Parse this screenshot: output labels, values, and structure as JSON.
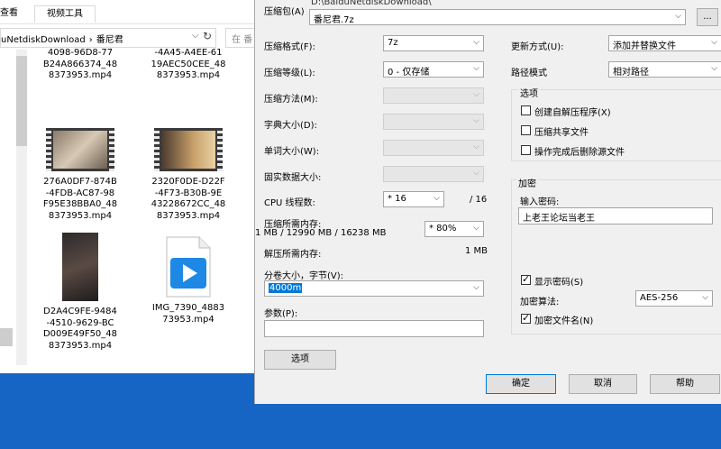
{
  "explorer": {
    "ribbon": {
      "tab_view": "查看",
      "tab_video_tools": "视频工具"
    },
    "address": {
      "segment1": "uNetdiskDownload",
      "segment2": "番尼君",
      "separator": "›"
    },
    "search_placeholder": "在 番",
    "files": [
      {
        "lines": [
          "4098-96D8-77",
          "B24A866374_48",
          "8373953.mp4"
        ]
      },
      {
        "lines": [
          "-4A45-A4EE-61",
          "19AEC50CEE_48",
          "8373953.mp4"
        ]
      },
      {
        "lines": [
          "276A0DF7-874B",
          "-4FDB-AC87-98",
          "F95E38BBA0_48",
          "8373953.mp4"
        ]
      },
      {
        "lines": [
          "2320F0DE-D22F",
          "-4F73-B30B-9E",
          "43228672CC_48",
          "8373953.mp4"
        ]
      },
      {
        "lines": [
          "D2A4C9FE-9484",
          "-4510-9629-BC",
          "D009E49F50_48",
          "8373953.mp4"
        ]
      },
      {
        "lines": [
          "IMG_7390_4883",
          "73953.mp4"
        ]
      }
    ]
  },
  "dialog": {
    "archive_label": "压缩包(A)",
    "archive_path": "D:\\BaiduNetdiskDownload\\",
    "archive_name": "番尼君.7z",
    "browse_label": "...",
    "format_label": "压缩格式(F):",
    "format_value": "7z",
    "level_label": "压缩等级(L):",
    "level_value": "0 - 仅存储",
    "method_label": "压缩方法(M):",
    "dict_label": "字典大小(D):",
    "word_label": "单词大小(W):",
    "solid_label": "固实数据大小:",
    "threads_label": "CPU 线程数:",
    "threads_value": "* 16",
    "threads_total": "/ 16",
    "mem_comp_label": "压缩所需内存:",
    "mem_comp_detail": "1 MB / 12990 MB / 16238 MB",
    "mem_comp_percent": "* 80%",
    "mem_decomp_label": "解压所需内存:",
    "mem_decomp_value": "1 MB",
    "volume_label": "分卷大小，字节(V):",
    "volume_value": "4000m",
    "params_label": "参数(P):",
    "options_button": "选项",
    "update_label": "更新方式(U):",
    "update_value": "添加并替换文件",
    "path_label": "路径模式",
    "path_value": "相对路径",
    "options_group_title": "选项",
    "opt_sfx": "创建自解压程序(X)",
    "opt_shared": "压缩共享文件",
    "opt_delete": "操作完成后删除源文件",
    "encrypt_group_title": "加密",
    "password_label": "输入密码:",
    "password_value": "上老王论坛当老王",
    "show_password": "显示密码(S)",
    "enc_method_label": "加密算法:",
    "enc_method_value": "AES-256",
    "encrypt_names": "加密文件名(N)",
    "ok_button": "确定",
    "cancel_button": "取消",
    "help_button": "帮助"
  }
}
